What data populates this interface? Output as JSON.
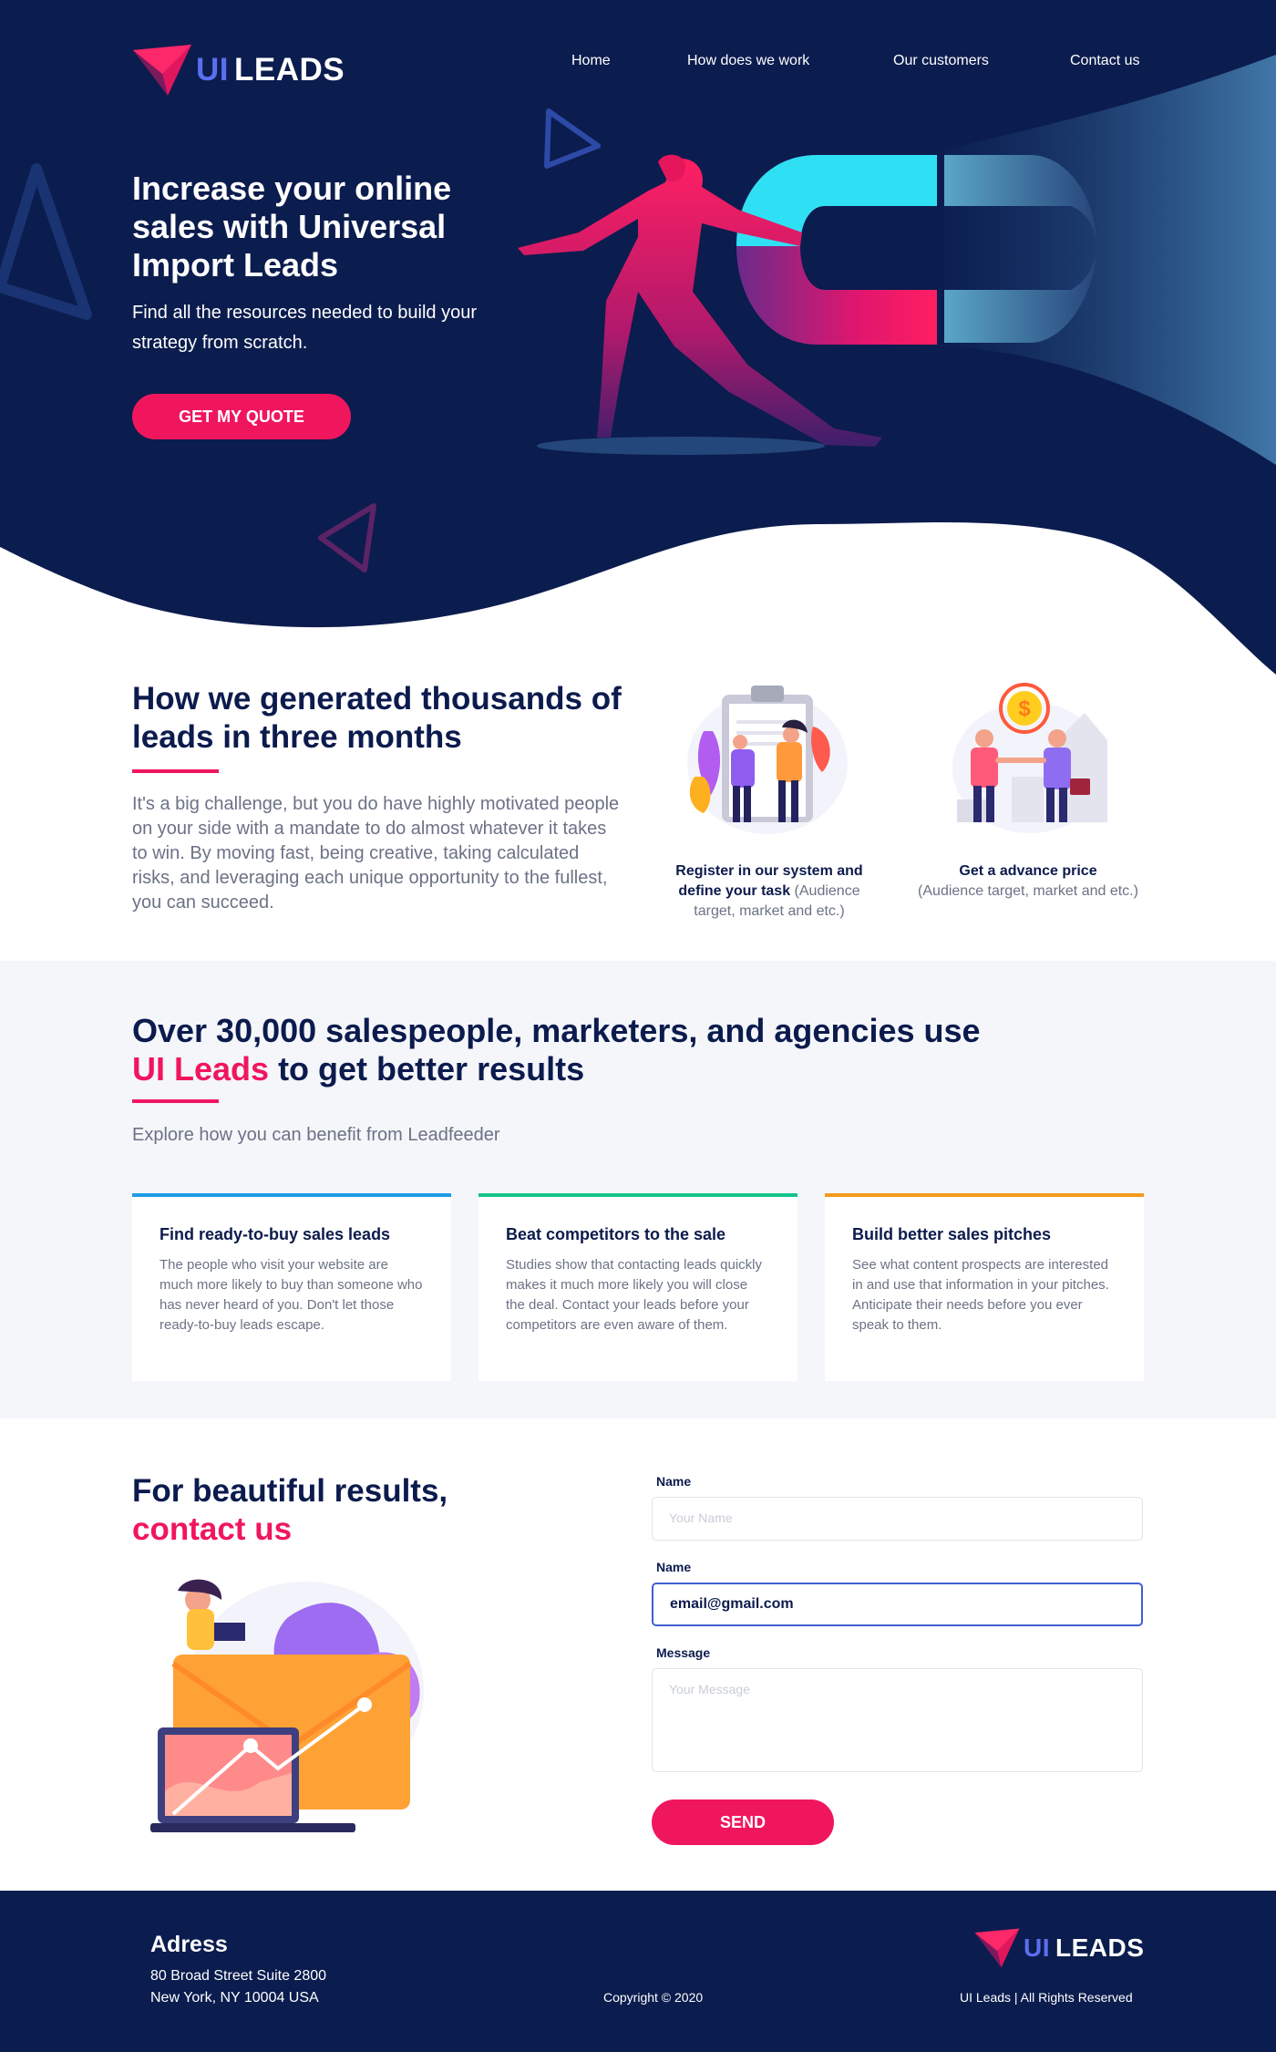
{
  "brand": {
    "ui": "UI",
    "leads": "LEADS",
    "colors": {
      "navy": "#0b1c4e",
      "pink": "#f0165e",
      "blue": "#5a6ff0",
      "cyan": "#2fe0f5"
    }
  },
  "nav": {
    "items": [
      {
        "label": "Home"
      },
      {
        "label": "How does we work"
      },
      {
        "label": "Our customers"
      },
      {
        "label": "Contact us"
      }
    ]
  },
  "hero": {
    "title": "Increase your online sales with Universal Import Leads",
    "subtitle": "Find all the resources needed to build your strategy from scratch.",
    "cta_label": "GET MY QUOTE"
  },
  "generated": {
    "title": "How we generated thousands of leads in three months",
    "paragraph": "It's a big challenge, but you do have highly motivated people on your side with a mandate to do almost whatever it takes to win. By moving fast, being creative, taking calculated risks, and leveraging each unique opportunity to the fullest, you can succeed.",
    "steps": [
      {
        "title": "Register in our system and define your task",
        "note": "(Audience target, market and etc.)",
        "icon": "clipboard-team-illustration"
      },
      {
        "title": "Get a advance price",
        "note": "(Audience target, market and etc.)",
        "icon": "handshake-coin-illustration"
      }
    ]
  },
  "benefits": {
    "title_part1": "Over 30,000 salespeople, marketers, and agencies use",
    "title_highlight": "UI Leads",
    "title_part2": "to get better results",
    "subtitle": "Explore how you can benefit from Leadfeeder",
    "cards": [
      {
        "title": "Find ready-to-buy sales leads",
        "text": "The people who visit your website are much more likely to buy than someone who has never heard of you. Don't let those ready-to-buy leads escape.",
        "accent": "#1e9be8"
      },
      {
        "title": "Beat competitors to the sale",
        "text": "Studies show that contacting leads quickly makes it much more likely you will close the deal. Contact your leads before your competitors are even aware of them.",
        "accent": "#14c48a"
      },
      {
        "title": "Build better sales pitches",
        "text": "See what content prospects are interested in and use that information in your pitches. Anticipate their needs before you ever speak to them.",
        "accent": "#f59a1b"
      }
    ]
  },
  "contact": {
    "title_part1": "For beautiful results,",
    "title_highlight": "contact us",
    "fields": [
      {
        "label": "Name",
        "placeholder": "Your Name",
        "value": ""
      },
      {
        "label": "Name",
        "placeholder": "",
        "value": "email@gmail.com"
      },
      {
        "label": "Message",
        "placeholder": "Your Message",
        "value": ""
      }
    ],
    "send_label": "SEND"
  },
  "footer": {
    "address_title": "Adress",
    "address_line1": "80 Broad Street Suite 2800",
    "address_line2": "New York, NY 10004 USA",
    "copyright": "Copyright © 2020",
    "rights": "UI Leads | All Rights Reserved"
  }
}
